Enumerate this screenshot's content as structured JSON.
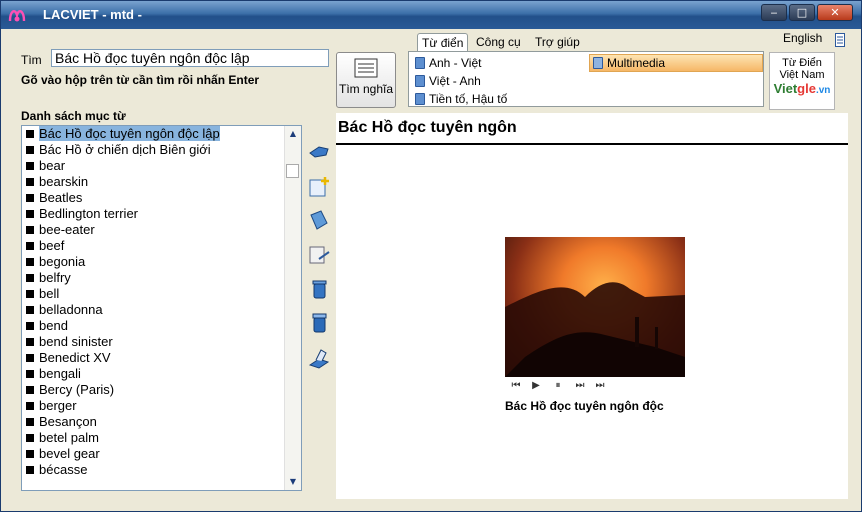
{
  "window": {
    "title": "LACVIET - mtd -",
    "controls": {
      "minimize": "‒",
      "maximize": "□",
      "close": "✕"
    }
  },
  "search": {
    "label": "Tìm",
    "value": "Bác Hồ đọc tuyên ngôn độc lập",
    "hint": "Gõ vào hộp trên từ cần tìm rồi nhấn Enter",
    "button_label": "Tìm nghĩa"
  },
  "tabs": [
    "Từ điển",
    "Công cụ",
    "Trợ giúp"
  ],
  "dictionaries": [
    {
      "label": "Anh - Việt"
    },
    {
      "label": "Việt - Anh"
    },
    {
      "label": "Tiền tố, Hậu tố"
    },
    {
      "label": "Multimedia",
      "selected": true
    }
  ],
  "language_toggle": "English",
  "vn_dictionary": {
    "line1": "Từ Điển",
    "line2": "Việt Nam",
    "logo": "Vietgle.vn"
  },
  "entry_list": {
    "heading": "Danh sách mục từ",
    "items": [
      "Bác Hồ đọc tuyên ngôn độc lập",
      "Bác Hồ ở chiến dịch Biên giới",
      "bear",
      "bearskin",
      "Beatles",
      "Bedlington terrier",
      "bee-eater",
      "beef",
      "begonia",
      "belfry",
      "bell",
      "belladonna",
      "bend",
      "bend sinister",
      "Benedict XV",
      "bengali",
      "Bercy (Paris)",
      "berger",
      "Besançon",
      "betel palm",
      "bevel gear",
      "bécasse"
    ],
    "selected_index": 0
  },
  "content": {
    "title": "Bác Hồ đọc tuyên ngôn",
    "caption": "Bác Hồ đọc tuyên ngôn độc",
    "video_controls": [
      "⏮",
      "▶",
      "⏸",
      "⏭",
      "⏭"
    ]
  },
  "colors": {
    "selected_row": "#88b4de",
    "multimedia_highlight": "#f6b767",
    "titlebar": "#2a5a96"
  }
}
